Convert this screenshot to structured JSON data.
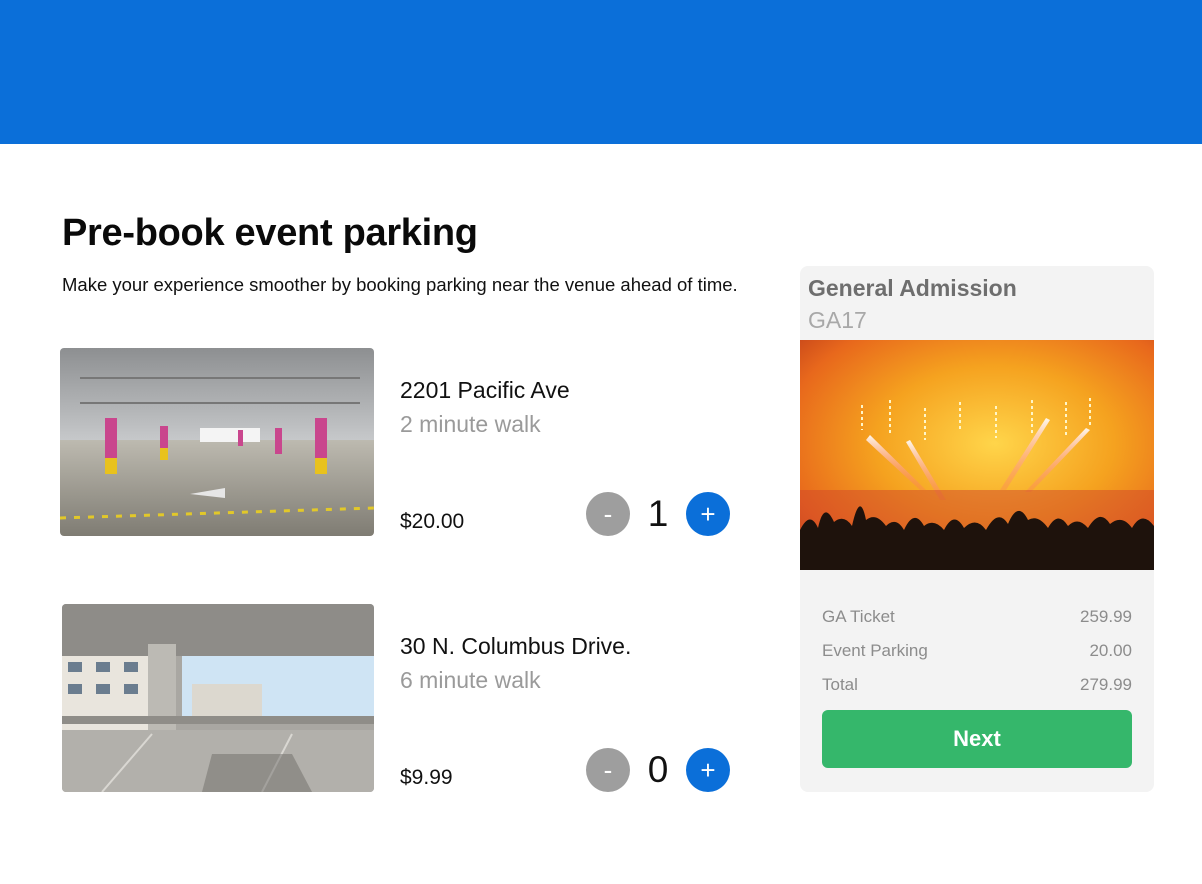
{
  "header": {
    "bar_color": "#0b6fd9"
  },
  "page": {
    "title": "Pre-book event parking",
    "subtitle": "Make your experience smoother by booking parking near the venue ahead of time."
  },
  "lots": [
    {
      "name": "2201 Pacific Ave",
      "walk": "2 minute walk",
      "price": "$20.00",
      "minus_label": "-",
      "quantity": "1",
      "plus_label": "+"
    },
    {
      "name": "30 N. Columbus Drive.",
      "walk": "6 minute walk",
      "price": "$9.99",
      "minus_label": "-",
      "quantity": "0",
      "plus_label": "+"
    }
  ],
  "summary": {
    "title": "General Admission",
    "code": "GA17",
    "lines": [
      {
        "label": "GA Ticket",
        "value": "259.99"
      },
      {
        "label": "Event Parking",
        "value": "20.00"
      },
      {
        "label": "Total",
        "value": "279.99"
      }
    ],
    "next_label": "Next"
  },
  "colors": {
    "accent_blue": "#0b6fd9",
    "minus_gray": "#9e9e9e",
    "next_green": "#35b76b",
    "card_bg": "#f3f3f3"
  }
}
